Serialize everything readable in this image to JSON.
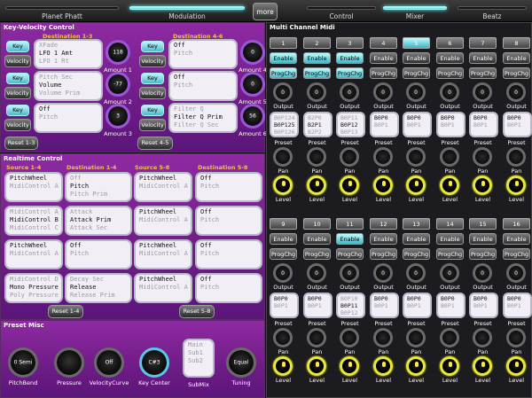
{
  "tabs": [
    {
      "label": "Planet Phatt",
      "active": false
    },
    {
      "label": "Modulation",
      "active": true
    },
    {
      "label": "Control",
      "active": false
    },
    {
      "label": "Mixer",
      "active": true
    },
    {
      "label": "Beatz",
      "active": false
    }
  ],
  "more_label": "more",
  "key_velocity": {
    "title": "Key-Velocity Control",
    "dest_1_3": "Destination 1-3",
    "dest_4_6": "Destination 4-6",
    "key_label": "Key",
    "velocity_label": "Velocity",
    "rows_left": [
      {
        "lines": [
          "XFade",
          "LFO 1 Amt",
          "LFO 1 Rt"
        ],
        "amount": "118",
        "amount_label": "Amount 1"
      },
      {
        "lines": [
          "Pitch Sec",
          "Volume",
          "Volume Prim"
        ],
        "amount": "-77",
        "amount_label": "Amount 2"
      },
      {
        "lines": [
          "",
          "Off",
          "Pitch"
        ],
        "amount": "3",
        "amount_label": "Amount 3"
      }
    ],
    "rows_right": [
      {
        "lines": [
          "",
          "Off",
          "Pitch"
        ],
        "amount": "0",
        "amount_label": "Amount 4"
      },
      {
        "lines": [
          "",
          "Off",
          "Pitch"
        ],
        "amount": "0",
        "amount_label": "Amount 5"
      },
      {
        "lines": [
          "Filter Q",
          "Filter Q Prim",
          "Filter Q Sec"
        ],
        "amount": "56",
        "amount_label": "Amount 6"
      }
    ],
    "reset_1_3": "Reset 1-3",
    "reset_4_5": "Reset 4-5"
  },
  "realtime": {
    "title": "Realtime Control",
    "src_1_4": "Source 1-4",
    "dest_1_4": "Destination 1-4",
    "src_5_8": "Source 5-8",
    "dest_5_8": "Destination 5-8",
    "rows": [
      {
        "src": [
          "",
          "PitchWheel",
          "MidiControl A"
        ],
        "dst": [
          "Off",
          "Pitch",
          "Pitch Prim"
        ],
        "src2": [
          "",
          "PitchWheel",
          "MidiControl A"
        ],
        "dst2": [
          "",
          "Off",
          "Pitch"
        ]
      },
      {
        "src": [
          "MidiControl A",
          "MidiControl B",
          "MidiControl C"
        ],
        "dst": [
          "Attack",
          "Attack Prim",
          "Attack Sec"
        ],
        "src2": [
          "",
          "PitchWheel",
          "MidiControl A"
        ],
        "dst2": [
          "",
          "Off",
          "Pitch"
        ]
      },
      {
        "src": [
          "",
          "PitchWheel",
          "MidiControl A"
        ],
        "dst": [
          "",
          "Off",
          "Pitch"
        ],
        "src2": [
          "",
          "PitchWheel",
          "MidiControl A"
        ],
        "dst2": [
          "",
          "Off",
          "Pitch"
        ]
      },
      {
        "src": [
          "MidiControl D",
          "Mono Pressure",
          "Poly Pressure"
        ],
        "dst": [
          "Decay Sec",
          "Release",
          "Release Prim"
        ],
        "src2": [
          "",
          "PitchWheel",
          "MidiControl A"
        ],
        "dst2": [
          "",
          "Off",
          "Pitch"
        ]
      }
    ],
    "reset_1_4": "Reset 1-4",
    "reset_5_8": "Reset 5-8"
  },
  "preset_misc": {
    "title": "Preset Misc",
    "knobs": [
      {
        "value": "0 Semi",
        "label": "PitchBend"
      },
      {
        "value": "",
        "label": "Pressure"
      },
      {
        "value": "Off",
        "label": "VelocityCurve"
      },
      {
        "value": "C#3",
        "label": "Key Center"
      }
    ],
    "submix_lines": [
      "Main",
      "Sub1",
      "Sub2"
    ],
    "submix_label": "SubMix",
    "tuning_value": "Equal",
    "tuning_label": "Tuning"
  },
  "multi": {
    "title": "Multi Channel Midi",
    "enable_label": "Enable",
    "progchg_label": "ProgChg",
    "output_label": "Output",
    "preset_label": "Preset",
    "pan_label": "Pan",
    "level_label": "Level",
    "channels_top": [
      {
        "num": "1",
        "selected": false,
        "enable_on": true,
        "prog_on": true,
        "out": "0",
        "preset": [
          "B0P124",
          "B0P125",
          "B0P126"
        ]
      },
      {
        "num": "2",
        "selected": false,
        "enable_on": true,
        "prog_on": true,
        "out": "0",
        "preset": [
          "B2P0",
          "B2P1",
          "B2P2"
        ]
      },
      {
        "num": "3",
        "selected": false,
        "enable_on": true,
        "prog_on": true,
        "out": "0",
        "preset": [
          "B0P11",
          "B0P12",
          "B0P13"
        ]
      },
      {
        "num": "4",
        "selected": false,
        "enable_on": false,
        "prog_on": false,
        "out": "0",
        "preset": [
          "",
          "B0P0",
          "B0P1"
        ]
      },
      {
        "num": "5",
        "selected": true,
        "enable_on": false,
        "prog_on": false,
        "out": "0",
        "preset": [
          "",
          "B0P0",
          "B0P1"
        ]
      },
      {
        "num": "6",
        "selected": false,
        "enable_on": false,
        "prog_on": false,
        "out": "0",
        "preset": [
          "",
          "B0P0",
          "B0P1"
        ]
      },
      {
        "num": "7",
        "selected": false,
        "enable_on": false,
        "prog_on": false,
        "out": "0",
        "preset": [
          "",
          "B0P0",
          "B0P1"
        ]
      },
      {
        "num": "8",
        "selected": false,
        "enable_on": false,
        "prog_on": false,
        "out": "0",
        "preset": [
          "",
          "B0P0",
          "B0P1"
        ]
      }
    ],
    "channels_bottom": [
      {
        "num": "9",
        "selected": false,
        "enable_on": false,
        "prog_on": false,
        "out": "0",
        "preset": [
          "",
          "B0P0",
          "B0P1"
        ]
      },
      {
        "num": "10",
        "selected": false,
        "enable_on": false,
        "prog_on": false,
        "out": "0",
        "preset": [
          "",
          "B0P0",
          "B0P1"
        ]
      },
      {
        "num": "11",
        "selected": false,
        "enable_on": true,
        "prog_on": false,
        "out": "0",
        "preset": [
          "B0P10",
          "B0P11",
          "B0P12"
        ]
      },
      {
        "num": "12",
        "selected": false,
        "enable_on": false,
        "prog_on": false,
        "out": "0",
        "preset": [
          "",
          "B0P0",
          "B0P1"
        ]
      },
      {
        "num": "13",
        "selected": false,
        "enable_on": false,
        "prog_on": false,
        "out": "0",
        "preset": [
          "",
          "B0P0",
          "B0P1"
        ]
      },
      {
        "num": "14",
        "selected": false,
        "enable_on": false,
        "prog_on": false,
        "out": "0",
        "preset": [
          "",
          "B0P0",
          "B0P1"
        ]
      },
      {
        "num": "15",
        "selected": false,
        "enable_on": false,
        "prog_on": false,
        "out": "0",
        "preset": [
          "",
          "B0P0",
          "B0P1"
        ]
      },
      {
        "num": "16",
        "selected": false,
        "enable_on": false,
        "prog_on": false,
        "out": "0",
        "preset": [
          "",
          "B0P0",
          "B0P1"
        ]
      }
    ]
  },
  "colors": {
    "accent": "#48d7e6",
    "panel": "#7a1f90",
    "level_ring": "#e8e83a",
    "header": "#f0c050"
  }
}
